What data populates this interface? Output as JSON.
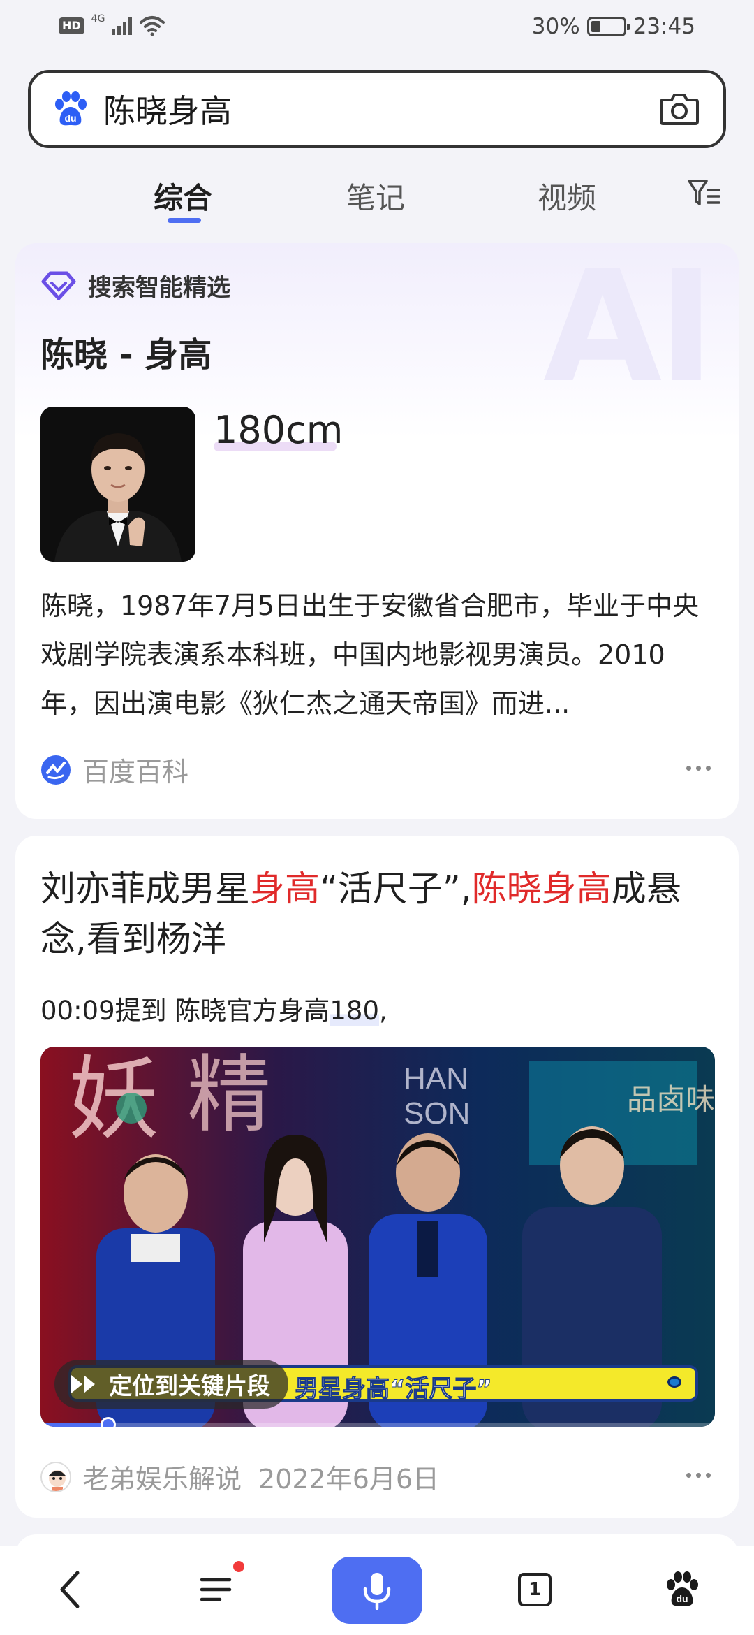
{
  "status_bar": {
    "hd": "HD",
    "network": "4G",
    "battery": "30%",
    "battery_level": 0.3,
    "time": "23:45"
  },
  "search": {
    "query": "陈晓身高"
  },
  "tabs": [
    {
      "label": "综合",
      "active": true
    },
    {
      "label": "笔记",
      "active": false
    },
    {
      "label": "视频",
      "active": false
    }
  ],
  "ai_card": {
    "header": "搜索智能精选",
    "watermark": "AI",
    "title": "陈晓 - 身高",
    "height": "180cm",
    "description": "陈晓，1987年7月5日出生于安徽省合肥市，毕业于中央戏剧学院表演系本科班，中国内地影视男演员。2010年，因出演电影《狄仁杰之通天帝国》而进...",
    "source": "百度百科"
  },
  "video_card": {
    "title_parts": [
      {
        "text": "刘亦菲成男星",
        "highlight": false
      },
      {
        "text": "身高",
        "highlight": true
      },
      {
        "text": "“活尺子”,",
        "highlight": false
      },
      {
        "text": "陈晓身高",
        "highlight": true
      },
      {
        "text": "成悬念,看到杨洋",
        "highlight": false
      }
    ],
    "clip_prefix": "00:09提到  陈晓官方身高",
    "clip_number": "180",
    "clip_suffix": ",",
    "locate_label": "定位到关键片段",
    "caption": "男星身高“活尺子”",
    "progress": 0.1,
    "author": "老弟娱乐解说",
    "date": "2022年6月6日"
  },
  "bottom_nav": {
    "tab_count": "1"
  },
  "colors": {
    "accent": "#4e6ef2",
    "highlight_red": "#e02a2a",
    "notification_red": "#f23a3a"
  }
}
